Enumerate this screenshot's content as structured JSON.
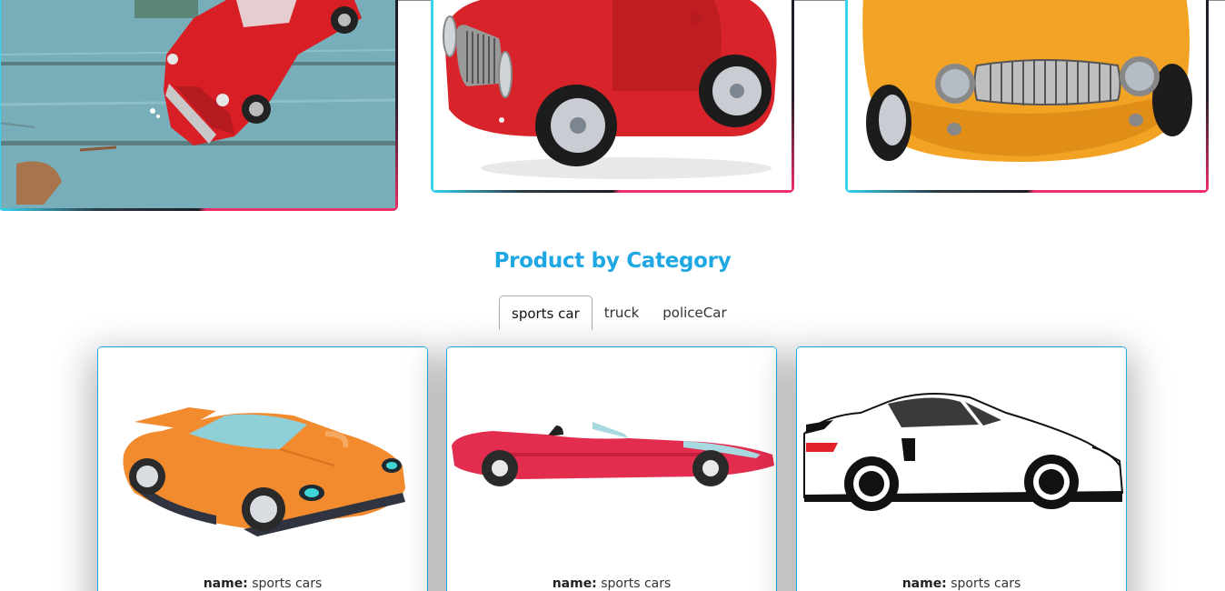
{
  "gallery": {
    "items": [
      {
        "alt": "red vintage toy car on wooden boards"
      },
      {
        "alt": "red cartoon toy car"
      },
      {
        "alt": "orange cartoon toy car"
      }
    ]
  },
  "category_section": {
    "title": "Product by Category",
    "tabs": [
      {
        "label": "sports car",
        "active": true
      },
      {
        "label": "truck",
        "active": false
      },
      {
        "label": "policeCar",
        "active": false
      }
    ],
    "cards": [
      {
        "name_label": "name:",
        "name_value": "sports cars",
        "image": "orange sports car illustration"
      },
      {
        "name_label": "name:",
        "name_value": "sports cars",
        "image": "red convertible illustration"
      },
      {
        "name_label": "name:",
        "name_value": "sports cars",
        "image": "white porsche illustration"
      }
    ]
  },
  "colors": {
    "accent": "#1ea7e2",
    "border_cyan": "#36d4f0",
    "border_pink": "#ef2f6a"
  }
}
